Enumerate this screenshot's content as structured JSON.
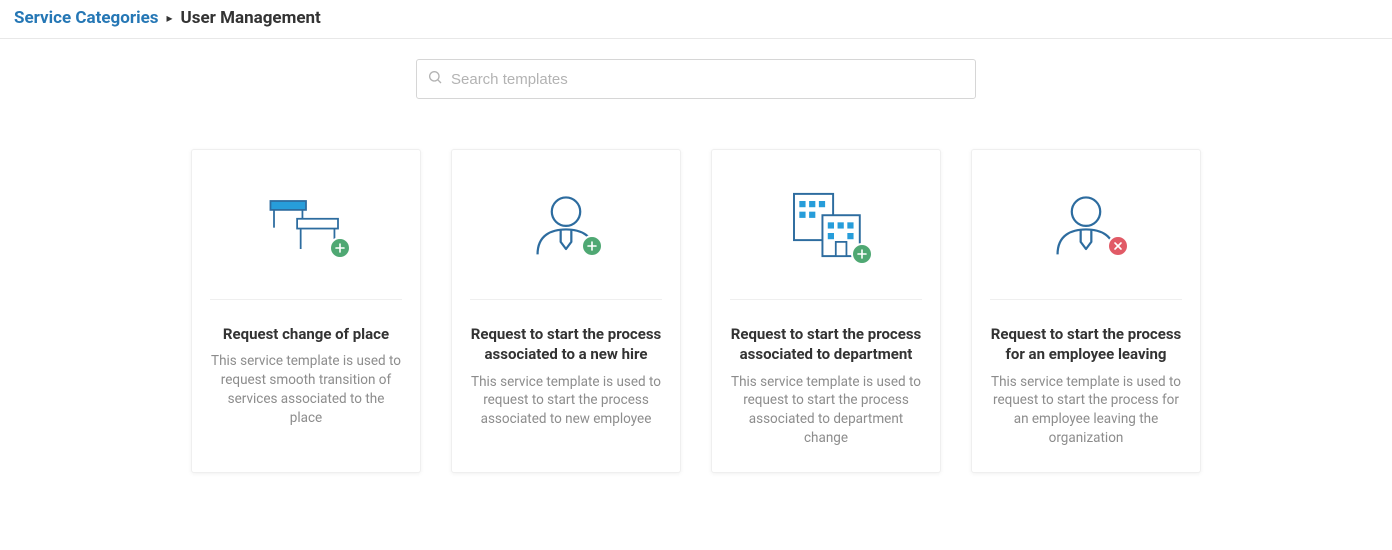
{
  "breadcrumb": {
    "root": "Service Categories",
    "current": "User Management"
  },
  "search": {
    "placeholder": "Search templates"
  },
  "cards": [
    {
      "title": "Request change of place",
      "desc": "This service template is used to request smooth transition of services associated to the place"
    },
    {
      "title": "Request to start the process associated to a new hire",
      "desc": "This service template is used to request to start the process associated to new employee"
    },
    {
      "title": "Request to start the process associated to department",
      "desc": "This service template is used to request to start the process associated to department change"
    },
    {
      "title": "Request to start the process for an employee leaving",
      "desc": "This service template is used to request to start the process for an employee leaving the organization"
    }
  ]
}
